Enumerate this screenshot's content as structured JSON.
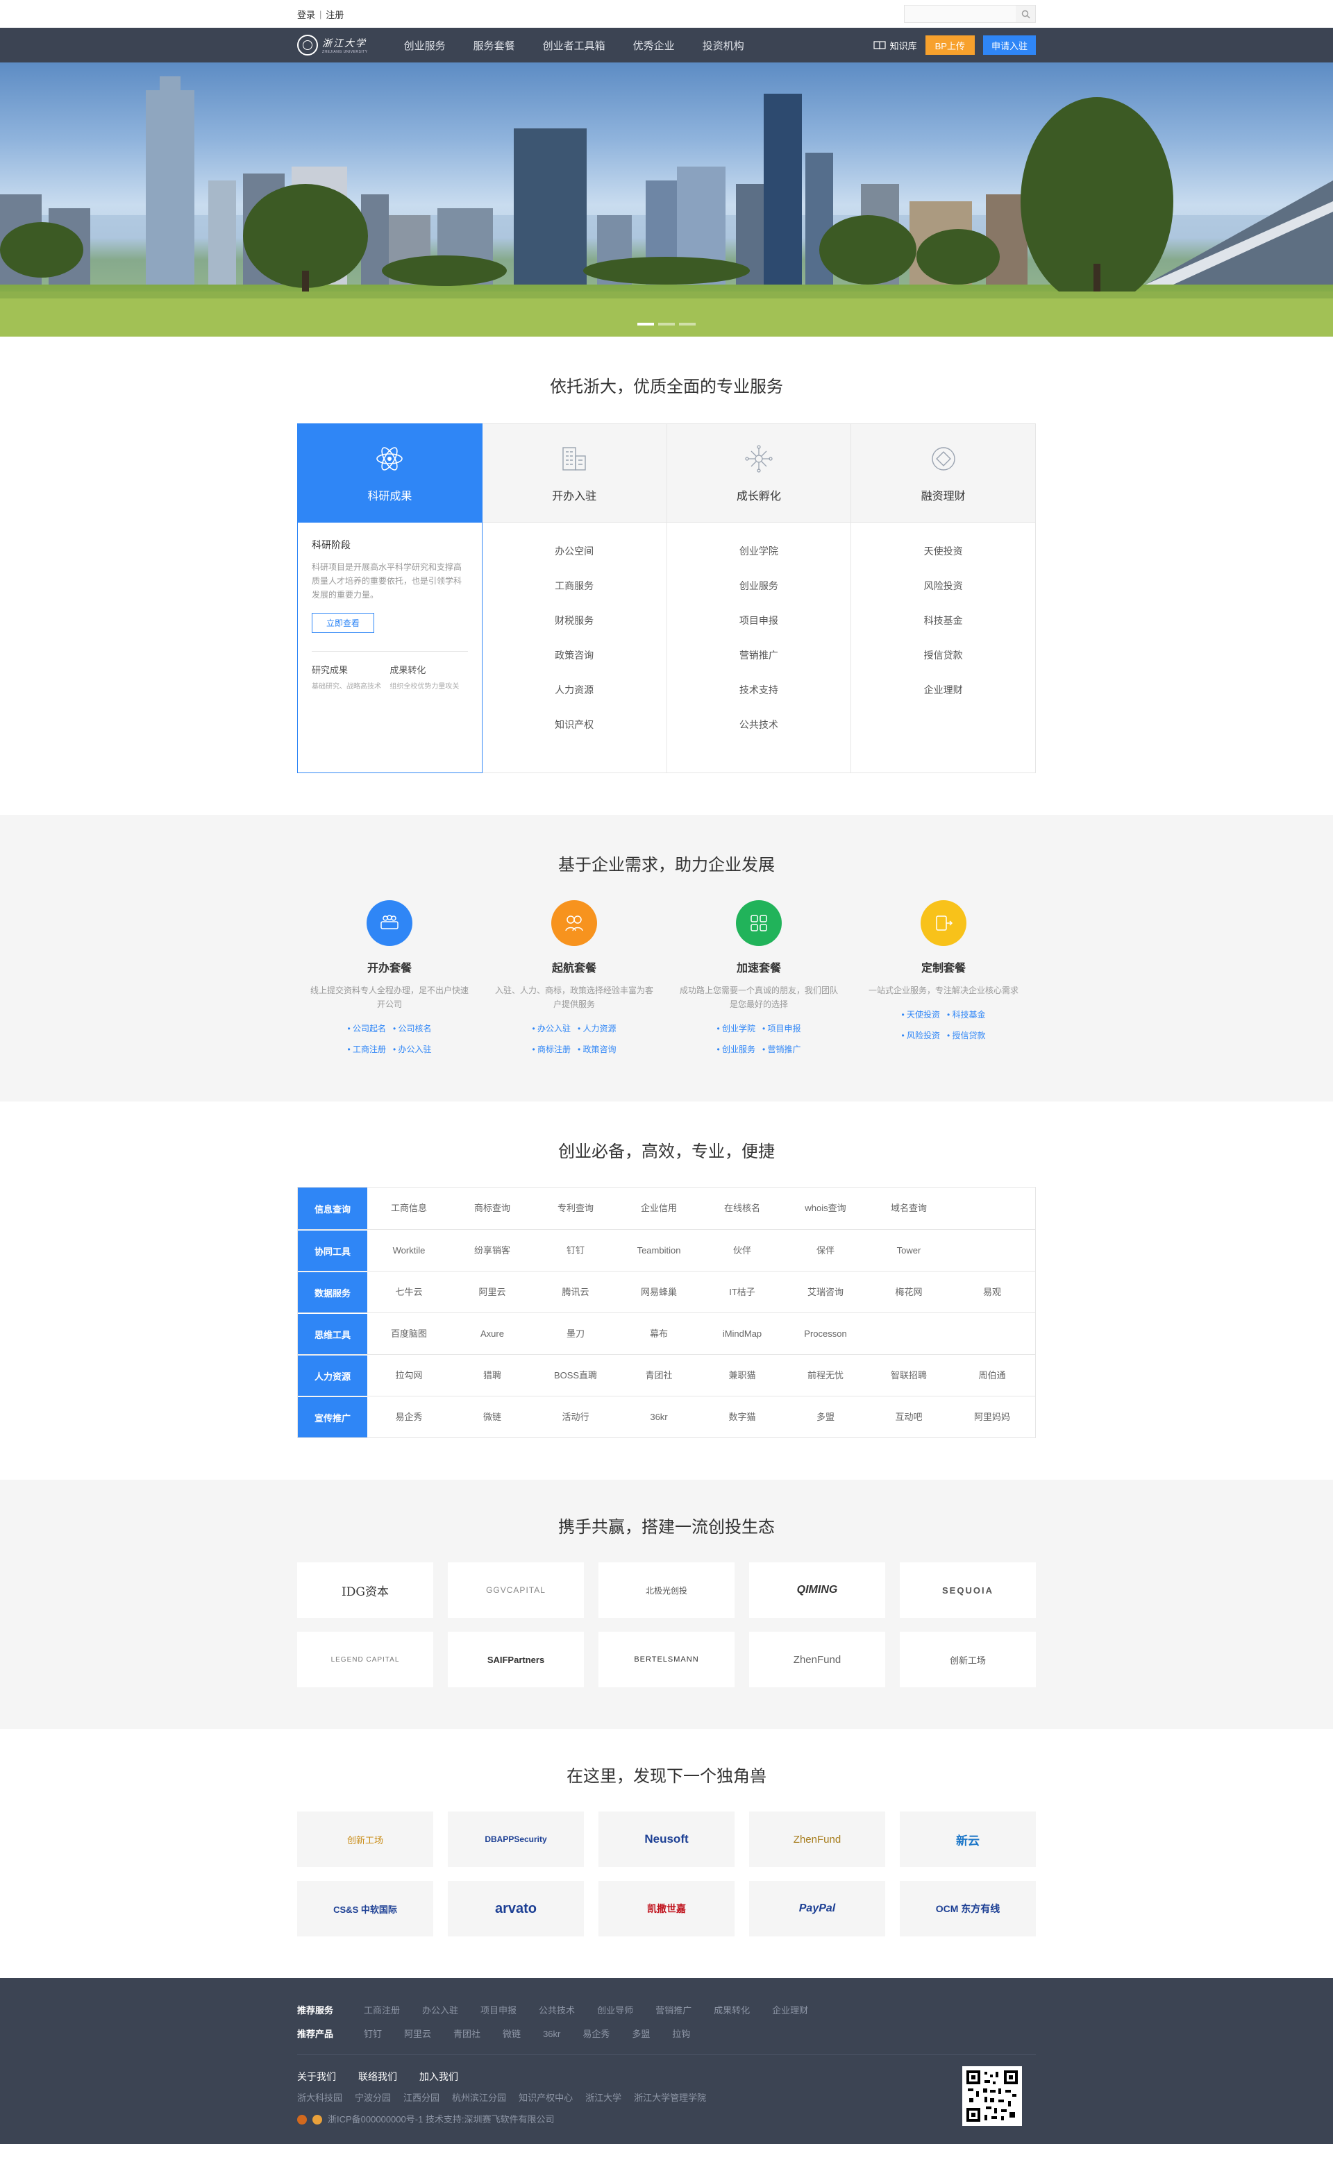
{
  "topbar": {
    "login": "登录",
    "sep": "|",
    "register": "注册",
    "search_placeholder": ""
  },
  "nav": {
    "logo_cn": "浙江大学",
    "logo_en": "ZHEJIANG UNIVERSITY",
    "menu": [
      "创业服务",
      "服务套餐",
      "创业者工具箱",
      "优秀企业",
      "投资机构"
    ],
    "knowledge": "知识库",
    "bp_upload": "BP上传",
    "apply": "申请入驻"
  },
  "services": {
    "title": "依托浙大，优质全面的专业服务",
    "cols": [
      {
        "title": "科研成果",
        "icon": "atom-icon"
      },
      {
        "title": "开办入驻",
        "icon": "building-icon",
        "items": [
          "办公空间",
          "工商服务",
          "财税服务",
          "政策咨询",
          "人力资源",
          "知识产权"
        ]
      },
      {
        "title": "成长孵化",
        "icon": "network-icon",
        "items": [
          "创业学院",
          "创业服务",
          "项目申报",
          "营销推广",
          "技术支持",
          "公共技术"
        ]
      },
      {
        "title": "融资理财",
        "icon": "diamond-icon",
        "items": [
          "天使投资",
          "风险投资",
          "科技基金",
          "授信贷款",
          "企业理财"
        ]
      }
    ],
    "detail": {
      "heading": "科研阶段",
      "desc": "科研项目是开展高水平科学研究和支撑高质量人才培养的重要依托，也是引领学科发展的重要力量。",
      "button": "立即查看",
      "sub1_title": "研究成果",
      "sub1_desc": "基础研究、战略高技术",
      "sub2_title": "成果转化",
      "sub2_desc": "组织全校优势力量攻关"
    }
  },
  "packages": {
    "title": "基于企业需求，助力企业发展",
    "items": [
      {
        "title": "开办套餐",
        "desc": "线上提交资料专人全程办理，足不出户快速开公司",
        "tags": [
          "公司起名",
          "公司核名",
          "工商注册",
          "办公入驻"
        ],
        "color": "#2f86f6"
      },
      {
        "title": "起航套餐",
        "desc": "入驻、人力、商标，政策选择经验丰富为客户提供服务",
        "tags": [
          "办公入驻",
          "人力资源",
          "商标注册",
          "政策咨询"
        ],
        "color": "#f7931e"
      },
      {
        "title": "加速套餐",
        "desc": "成功路上您需要一个真诚的朋友，我们团队是您最好的选择",
        "tags": [
          "创业学院",
          "项目申报",
          "创业服务",
          "营销推广"
        ],
        "color": "#21b35a"
      },
      {
        "title": "定制套餐",
        "desc": "一站式企业服务，专注解决企业核心需求",
        "tags": [
          "天使投资",
          "科技基金",
          "风险投资",
          "授信贷款"
        ],
        "color": "#f8c21a"
      }
    ]
  },
  "tools": {
    "title": "创业必备，高效，专业，便捷",
    "rows": [
      {
        "cat": "信息查询",
        "items": [
          "工商信息",
          "商标查询",
          "专利查询",
          "企业信用",
          "在线核名",
          "whois查询",
          "域名查询"
        ]
      },
      {
        "cat": "协同工具",
        "items": [
          "Worktile",
          "纷享销客",
          "钉钉",
          "Teambition",
          "伙伴",
          "保伴",
          "Tower"
        ]
      },
      {
        "cat": "数据服务",
        "items": [
          "七牛云",
          "阿里云",
          "腾讯云",
          "网易蜂巢",
          "IT桔子",
          "艾瑞咨询",
          "梅花网",
          "易观"
        ]
      },
      {
        "cat": "思维工具",
        "items": [
          "百度脑图",
          "Axure",
          "墨刀",
          "幕布",
          "iMindMap",
          "Processon"
        ]
      },
      {
        "cat": "人力资源",
        "items": [
          "拉勾网",
          "猎聘",
          "BOSS直聘",
          "青团社",
          "兼职猫",
          "前程无忧",
          "智联招聘",
          "周伯通"
        ]
      },
      {
        "cat": "宣传推广",
        "items": [
          "易企秀",
          "微链",
          "活动行",
          "36kr",
          "数字猫",
          "多盟",
          "互动吧",
          "阿里妈妈"
        ]
      }
    ]
  },
  "partners": {
    "title": "携手共赢，搭建一流创投生态",
    "logos": [
      "IDG资本",
      "GGVCAPITAL",
      "北极光创投",
      "QIMING",
      "SEQUOIA",
      "LEGEND CAPITAL",
      "SAIFPartners",
      "BERTELSMANN",
      "ZhenFund",
      "创新工场"
    ]
  },
  "unicorn": {
    "title": "在这里，发现下一个独角兽",
    "logos": [
      "创新工场",
      "DBAPPSecurity",
      "Neusoft",
      "ZhenFund",
      "新云",
      "CS&S 中软国际",
      "arvato",
      "凯撒世嘉",
      "PayPal",
      "OCM 东方有线"
    ]
  },
  "footer": {
    "rec_services_label": "推荐服务",
    "rec_services": [
      "工商注册",
      "办公入驻",
      "项目申报",
      "公共技术",
      "创业导师",
      "营销推广",
      "成果转化",
      "企业理财"
    ],
    "rec_products_label": "推荐产品",
    "rec_products": [
      "钉钉",
      "阿里云",
      "青团社",
      "微链",
      "36kr",
      "易企秀",
      "多盟",
      "拉钩"
    ],
    "links": [
      "关于我们",
      "联络我们",
      "加入我们"
    ],
    "sites": [
      "浙大科技园",
      "宁波分园",
      "江西分园",
      "杭州滨江分园",
      "知识产权中心",
      "浙江大学",
      "浙江大学管理学院"
    ],
    "copyright": "浙ICP备000000000号-1  技术支持:深圳赛飞软件有限公司"
  }
}
